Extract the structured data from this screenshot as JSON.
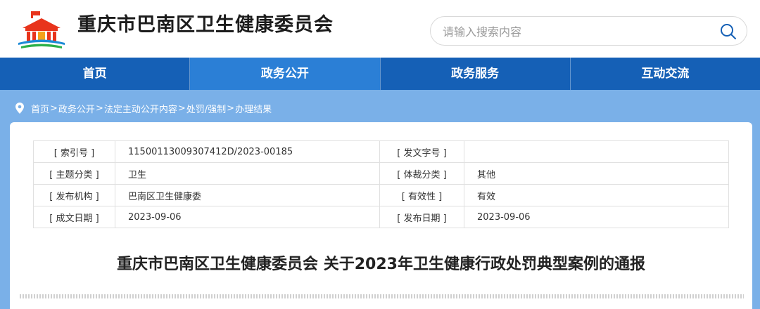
{
  "header": {
    "site_title": "重庆市巴南区卫生健康委员会",
    "logo_icon": "government-emblem-icon",
    "search_placeholder": "请输入搜索内容",
    "search_icon": "search-icon"
  },
  "nav": {
    "items": [
      {
        "label": "首页",
        "active": false
      },
      {
        "label": "政务公开",
        "active": true
      },
      {
        "label": "政务服务",
        "active": false
      },
      {
        "label": "互动交流",
        "active": false
      }
    ]
  },
  "breadcrumb": {
    "icon": "location-pin-icon",
    "items": [
      "首页",
      "政务公开",
      "法定主动公开内容",
      "处罚/强制",
      "办理结果"
    ],
    "separator": ">"
  },
  "meta": {
    "rows": [
      {
        "l1": "[ 索引号 ]",
        "v1": "11500113009307412D/2023-00185",
        "l2": "[ 发文字号 ]",
        "v2": ""
      },
      {
        "l1": "[ 主题分类 ]",
        "v1": "卫生",
        "l2": "[ 体裁分类 ]",
        "v2": "其他"
      },
      {
        "l1": "[ 发布机构 ]",
        "v1": "巴南区卫生健康委",
        "l2": "[ 有效性 ]",
        "v2": "有效"
      },
      {
        "l1": "[ 成文日期 ]",
        "v1": "2023-09-06",
        "l2": "[ 发布日期 ]",
        "v2": "2023-09-06"
      }
    ]
  },
  "document": {
    "title": "重庆市巴南区卫生健康委员会 关于2023年卫生健康行政处罚典型案例的通报"
  },
  "colors": {
    "nav_bg": "#1560b6",
    "nav_active": "#2b7fd6",
    "band_bg": "#7ab0e8"
  }
}
